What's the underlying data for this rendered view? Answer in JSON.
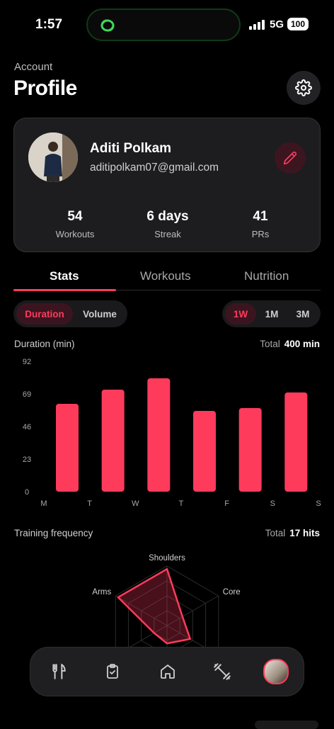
{
  "status": {
    "time": "1:57",
    "network": "5G",
    "battery": "100"
  },
  "header": {
    "crumb": "Account",
    "title": "Profile"
  },
  "profile": {
    "name": "Aditi Polkam",
    "email": "aditipolkam07@gmail.com",
    "stats": [
      {
        "value": "54",
        "label": "Workouts"
      },
      {
        "value": "6 days",
        "label": "Streak"
      },
      {
        "value": "41",
        "label": "PRs"
      }
    ]
  },
  "tabs": [
    "Stats",
    "Workouts",
    "Nutrition"
  ],
  "metric_toggle": [
    "Duration",
    "Volume"
  ],
  "range_toggle": [
    "1W",
    "1M",
    "3M"
  ],
  "duration_chart": {
    "label": "Duration (min)",
    "total_label": "Total",
    "total_value": "400 min"
  },
  "frequency": {
    "label": "Training frequency",
    "total_label": "Total",
    "total_value": "17 hits"
  },
  "chart_data": [
    {
      "type": "bar",
      "title": "Duration (min)",
      "categories": [
        "M",
        "T",
        "W",
        "T",
        "F",
        "S",
        "S"
      ],
      "values": [
        62,
        72,
        80,
        57,
        59,
        70,
        0
      ],
      "yticks": [
        0,
        23,
        46,
        69,
        92
      ],
      "ylim": [
        0,
        92
      ],
      "color": "#ff3b5c"
    },
    {
      "type": "radar",
      "title": "Training frequency",
      "axes": [
        "Shoulders",
        "Core",
        "Arms"
      ],
      "color": "#ff3b5c"
    }
  ],
  "colors": {
    "accent": "#ff3b5c",
    "card": "#1d1d1f"
  },
  "nav": [
    "fork-knife-icon",
    "clipboard-check-icon",
    "home-icon",
    "dumbbell-icon",
    "avatar"
  ]
}
